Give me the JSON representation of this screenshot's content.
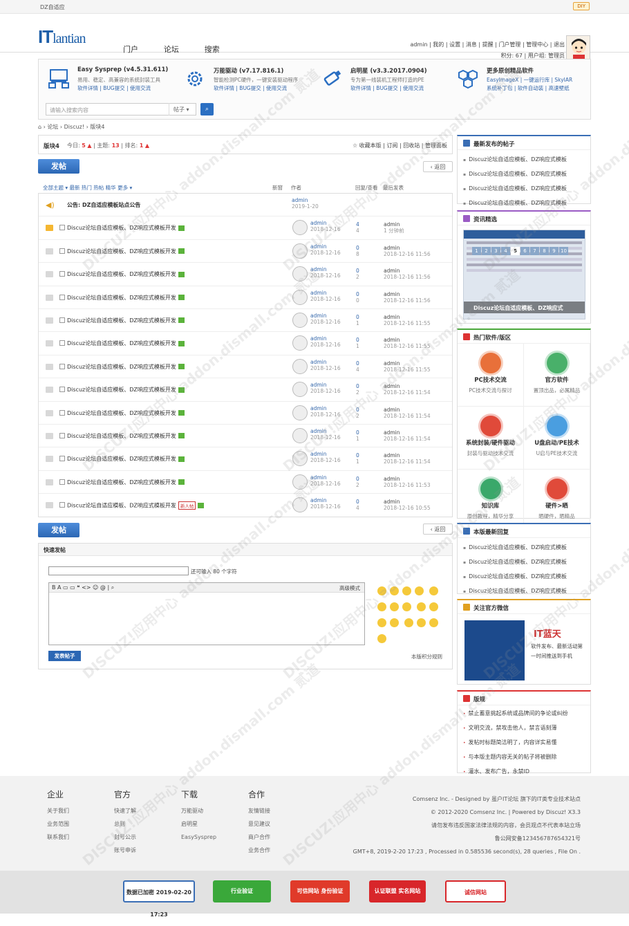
{
  "topbar": {
    "site_name": "DZ自适应",
    "diy": "DIY"
  },
  "logo": {
    "text_main": "IT",
    "text_sub": "lantian"
  },
  "nav": [
    "门户",
    "论坛",
    "搜索"
  ],
  "user": {
    "line1": "admin | 我的 | 设置 | 消息 | 提醒 | 门户管理 | 管理中心 | 退出",
    "line2": "积分: 67 | 用户组: 管理员"
  },
  "promo": [
    {
      "title": "Easy Sysprep (v4.5.31.611)",
      "desc": "易用、稳定、高兼容的系统封装工具",
      "links": "软件详情 | BUG提交 | 使用交流"
    },
    {
      "title": "万能驱动 (v7.17.816.1)",
      "desc": "智能检测PC硬件，一键安装驱动程序",
      "links": "软件详情 | BUG提交 | 使用交流"
    },
    {
      "title": "启明星 (v3.3.2017.0904)",
      "desc": "专为第一线装机工程师打造的PE",
      "links": "软件详情 | BUG提交 | 使用交流"
    },
    {
      "title": "更多原创精品软件",
      "desc": "EasyImageX | 一键运行库 | SkyIAR",
      "links": "系统补丁包 | 软件自动装 | 高速壁纸"
    }
  ],
  "search": {
    "placeholder": "请输入搜索内容",
    "type": "帖子"
  },
  "breadcrumb": "⌂ › 论坛 › Discuz! › 版块4",
  "forum": {
    "name": "版块4",
    "today_label": "今日:",
    "today": "5",
    "topics_label": "主题:",
    "topics": "13",
    "rank_label": "排名:",
    "rank": "1",
    "actions": "☆ 收藏本版 | 订阅 | 回收站 | 管理面板"
  },
  "buttons": {
    "post": "发帖",
    "back": "返回",
    "post2": "发帖",
    "back2": "返回"
  },
  "filter": "全部主题 ▾   最新  热门  热帖  精华  更多 ▾",
  "columns": {
    "new": "新窗",
    "author": "作者",
    "reply": "回复/查看",
    "last": "最后发表"
  },
  "announcement": {
    "title": "公告: DZ自适应模板站点公告",
    "author": "admin",
    "date": "2019-1-20"
  },
  "threads": [
    {
      "title": "Discuz论坛自适应模板、DZ响应式模板开发",
      "hot": true,
      "author": "admin",
      "date": "2018-12-16",
      "r": "4",
      "v": "4",
      "last_user": "admin",
      "last_time": "1 分钟前",
      "badge": ""
    },
    {
      "title": "Discuz论坛自适应模板、DZ响应式模板开发",
      "hot": false,
      "author": "admin",
      "date": "2018-12-16",
      "r": "0",
      "v": "8",
      "last_user": "admin",
      "last_time": "2018-12-16 11:56",
      "badge": ""
    },
    {
      "title": "Discuz论坛自适应模板、DZ响应式模板开发",
      "hot": false,
      "author": "admin",
      "date": "2018-12-16",
      "r": "0",
      "v": "2",
      "last_user": "admin",
      "last_time": "2018-12-16 11:56",
      "badge": ""
    },
    {
      "title": "Discuz论坛自适应模板、DZ响应式模板开发",
      "hot": false,
      "author": "admin",
      "date": "2018-12-16",
      "r": "0",
      "v": "0",
      "last_user": "admin",
      "last_time": "2018-12-16 11:56",
      "badge": ""
    },
    {
      "title": "Discuz论坛自适应模板、DZ响应式模板开发",
      "hot": false,
      "author": "admin",
      "date": "2018-12-16",
      "r": "0",
      "v": "1",
      "last_user": "admin",
      "last_time": "2018-12-16 11:55",
      "badge": ""
    },
    {
      "title": "Discuz论坛自适应模板、DZ响应式模板开发",
      "hot": false,
      "author": "admin",
      "date": "2018-12-16",
      "r": "0",
      "v": "1",
      "last_user": "admin",
      "last_time": "2018-12-16 11:55",
      "badge": ""
    },
    {
      "title": "Discuz论坛自适应模板、DZ响应式模板开发",
      "hot": false,
      "author": "admin",
      "date": "2018-12-16",
      "r": "0",
      "v": "4",
      "last_user": "admin",
      "last_time": "2018-12-16 11:55",
      "badge": ""
    },
    {
      "title": "Discuz论坛自适应模板、DZ响应式模板开发",
      "hot": false,
      "author": "admin",
      "date": "2018-12-16",
      "r": "0",
      "v": "2",
      "last_user": "admin",
      "last_time": "2018-12-16 11:54",
      "badge": ""
    },
    {
      "title": "Discuz论坛自适应模板、DZ响应式模板开发",
      "hot": false,
      "author": "admin",
      "date": "2018-12-16",
      "r": "0",
      "v": "2",
      "last_user": "admin",
      "last_time": "2018-12-16 11:54",
      "badge": ""
    },
    {
      "title": "Discuz论坛自适应模板、DZ响应式模板开发",
      "hot": false,
      "author": "admin",
      "date": "2018-12-16",
      "r": "0",
      "v": "1",
      "last_user": "admin",
      "last_time": "2018-12-16 11:54",
      "badge": ""
    },
    {
      "title": "Discuz论坛自适应模板、DZ响应式模板开发",
      "hot": false,
      "author": "admin",
      "date": "2018-12-16",
      "r": "0",
      "v": "1",
      "last_user": "admin",
      "last_time": "2018-12-16 11:54",
      "badge": ""
    },
    {
      "title": "Discuz论坛自适应模板、DZ响应式模板开发",
      "hot": false,
      "author": "admin",
      "date": "2018-12-16",
      "r": "0",
      "v": "2",
      "last_user": "admin",
      "last_time": "2018-12-16 11:53",
      "badge": ""
    },
    {
      "title": "Discuz论坛自适应模板、DZ响应式模板开发",
      "hot": false,
      "author": "admin",
      "date": "2018-12-16",
      "r": "0",
      "v": "4",
      "last_user": "admin",
      "last_time": "2018-12-16 10:55",
      "badge": "新人帖"
    }
  ],
  "quick": {
    "heading": "快速发帖",
    "count_text": "还可输入 80 个字符",
    "toolbar": "B  A  ▭  ▭  ❝  <>  ☺  @  |  ⌕",
    "advanced": "高级模式",
    "submit": "发表帖子",
    "rules": "本版积分规则"
  },
  "sidebar": {
    "latest_title": "最新发布的帖子",
    "latest": [
      "Discuz论坛自适应模板、DZ响应式模板",
      "Discuz论坛自适应模板、DZ响应式模板",
      "Discuz论坛自适应模板、DZ响应式模板",
      "Discuz论坛自适应模板、DZ响应式模板"
    ],
    "news_title": "资讯精选",
    "news_pages": [
      "1",
      "2",
      "3",
      "4",
      "5",
      "6",
      "7",
      "8",
      "9",
      "10"
    ],
    "news_caption": "Discuz论坛自适应模板、DZ响应式",
    "hot_title": "热门软件/版区",
    "hot": [
      {
        "name": "PC技术交流",
        "desc": "PC技术交流与探讨",
        "color": "#e8703a"
      },
      {
        "name": "官方软件",
        "desc": "置顶出品，必属精品",
        "color": "#49b06a"
      },
      {
        "name": "系统封装/硬件驱动",
        "desc": "封装与驱动技术交流",
        "color": "#e04a3a"
      },
      {
        "name": "U盘启动/PE技术",
        "desc": "U启与PE技术交流",
        "color": "#4a9ee0"
      },
      {
        "name": "知识库",
        "desc": "原创教程，精华分享",
        "color": "#3aa86a"
      },
      {
        "name": "硬件>晒",
        "desc": "晒硬件，晒精品",
        "color": "#e04a3a"
      }
    ],
    "replies_title": "本版最新回复",
    "replies": [
      "Discuz论坛自适应模板、DZ响应式模板",
      "Discuz论坛自适应模板、DZ响应式模板",
      "Discuz论坛自适应模板、DZ响应式模板",
      "Discuz论坛自适应模板、DZ响应式模板"
    ],
    "wechat_title": "关注官方微信",
    "wechat_brand": "IT蓝天",
    "wechat_desc": "软件发布、最新活动第一时间推送到手机",
    "rules_title": "版规",
    "rules": [
      "禁止蓄意挑起系统或品牌间的争论或纠纷",
      "文明交流，禁攻击他人，禁言语刻薄",
      "发帖时标题简洁明了，内容详实易懂",
      "与本版主题内容无关的帖子将被删除",
      "灌水、发布广告，永禁ID"
    ]
  },
  "footer": {
    "cols": [
      {
        "h": "企业",
        "items": [
          "关于我们",
          "业务范围",
          "联系我们"
        ]
      },
      {
        "h": "官方",
        "items": [
          "快速了解",
          "总则",
          "封号公示",
          "账号申诉"
        ]
      },
      {
        "h": "下载",
        "items": [
          "万能驱动",
          "启明星",
          "EasySysprep"
        ]
      },
      {
        "h": "合作",
        "items": [
          "友情链接",
          "意见建议",
          "商户合作",
          "业务合作"
        ]
      }
    ],
    "right": [
      "Comsenz Inc. - Designed by 虽户IT论坛 旗下的IT类专业技术站点",
      "© 2012-2020 Comsenz Inc. | Powered by Discuz! X3.3",
      "请勿发布违反国家法律法规的内容，会员观点不代表本站立场",
      "鲁公网安备123456787654321号",
      "GMT+8, 2019-2-20 17:23 , Processed in 0.585536 second(s), 28 queries , File On ."
    ]
  },
  "badges": [
    {
      "text": "数据已加密 2019-02-20 17:23",
      "color": "#ffffff"
    },
    {
      "text": "行业验证",
      "color": "#3aa83a"
    },
    {
      "text": "可信网站 身份验证",
      "color": "#e03a2a"
    },
    {
      "text": "认证联盟 实名网站",
      "color": "#d8262a"
    },
    {
      "text": "诚信网站",
      "color": "#d8262a"
    }
  ],
  "watermark": "DISCUZ!应用中心 addon.dismall.com 贰道"
}
